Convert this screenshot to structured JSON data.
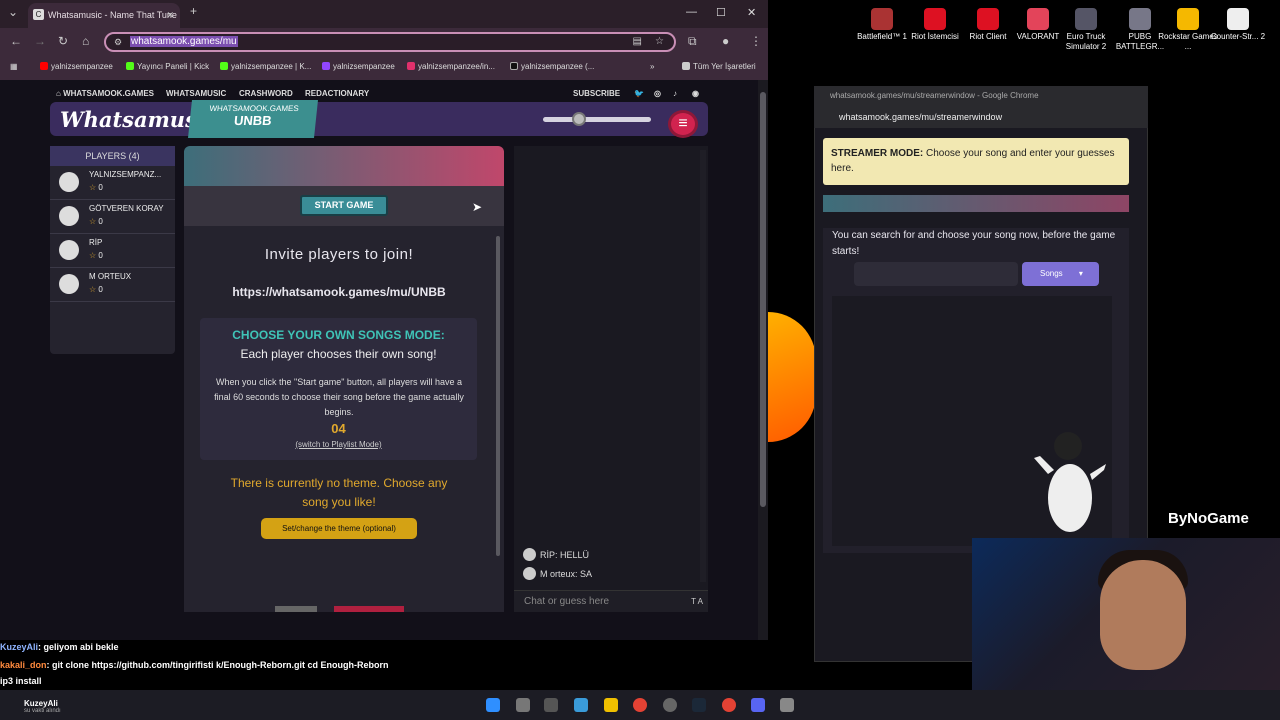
{
  "browser": {
    "tab_title": "Whatsamusic - Name That Tune",
    "url": "whatsamook.games/mu",
    "bookmarks": [
      "yalnizsempanzee",
      "Yayıncı Paneli | Kick",
      "yalnizsempanzee | K...",
      "yalnizsempanzee",
      "yalnizsempanzee/in...",
      "yalnizsempanzee (...",
      "Tüm Yer İşaretleri"
    ]
  },
  "nav": {
    "home": "WHATSAMOOK.GAMES",
    "music": "WHATSAMUSIC",
    "crash": "CRASHWORD",
    "redac": "REDACTIONARY",
    "subscribe": "SUBSCRIBE"
  },
  "header": {
    "logo": "Whatsamusic",
    "room_site": "WHATSAMOOK.GAMES",
    "room_code": "UNBB"
  },
  "players": {
    "title": "PLAYERS (4)",
    "list": [
      {
        "name": "YALNIZSEMPANZ...",
        "score": "0"
      },
      {
        "name": "GÖTVEREN KORAY",
        "score": "0"
      },
      {
        "name": "RİP",
        "score": "0"
      },
      {
        "name": "M ORTEUX",
        "score": "0"
      }
    ]
  },
  "game": {
    "start_label": "START GAME",
    "invite": "Invite players to join!",
    "invite_url": "https://whatsamook.games/mu/UNBB",
    "mode_title": "CHOOSE YOUR OWN SONGS MODE:",
    "mode_sub": "Each player chooses their own song!",
    "mode_desc": "When you click the \"Start game\" button, all players will have a final 60 seconds to choose their song before the game actually begins.",
    "countdown": "04",
    "switch_link": "(switch to Playlist Mode)",
    "theme_text": "There is currently no theme. Choose any song you like!",
    "theme_button": "Set/change the theme (optional)"
  },
  "chat": {
    "messages": [
      {
        "text": "RİP: HELLÜ"
      },
      {
        "text": "M orteux: SA"
      }
    ],
    "placeholder": "Chat or guess here",
    "font_btn": "T A"
  },
  "stream_chat": [
    {
      "user": "KuzeyAli",
      "msg": ": geliyom abi bekle"
    },
    {
      "user": "kakali_don",
      "msg": ": git clone https://github.com/tingirifisti k/Enough-Reborn.git cd Enough-Reborn"
    },
    {
      "user": "",
      "msg": "ip3 install"
    }
  ],
  "streamer": {
    "title": "whatsamook.games/mu/streamerwindow - Google Chrome",
    "url": "whatsamook.games/mu/streamerwindow",
    "note_bold": "STREAMER MODE:",
    "note": " Choose your song and enter your guesses here.",
    "text": "You can search for and choose your song now, before the game starts!",
    "songs_btn": "Songs"
  },
  "desktop_icons": [
    "Battlefield™ 1",
    "Riot İstemcisi",
    "Riot Client",
    "VALORANT",
    "Euro Truck Simulator 2",
    "PUBG BATTLEGR...",
    "Rockstar Games ...",
    "Counter-Str... 2"
  ],
  "overlay_brand": "ByNoGame",
  "taskbar_user": "KuzeyAli",
  "taskbar_user_sub": "su vakti alındı",
  "colors": {
    "accent": "#3fc4b7",
    "gold": "#e1a92d",
    "header": "#3a2c5e",
    "menu": "#d1234f"
  }
}
